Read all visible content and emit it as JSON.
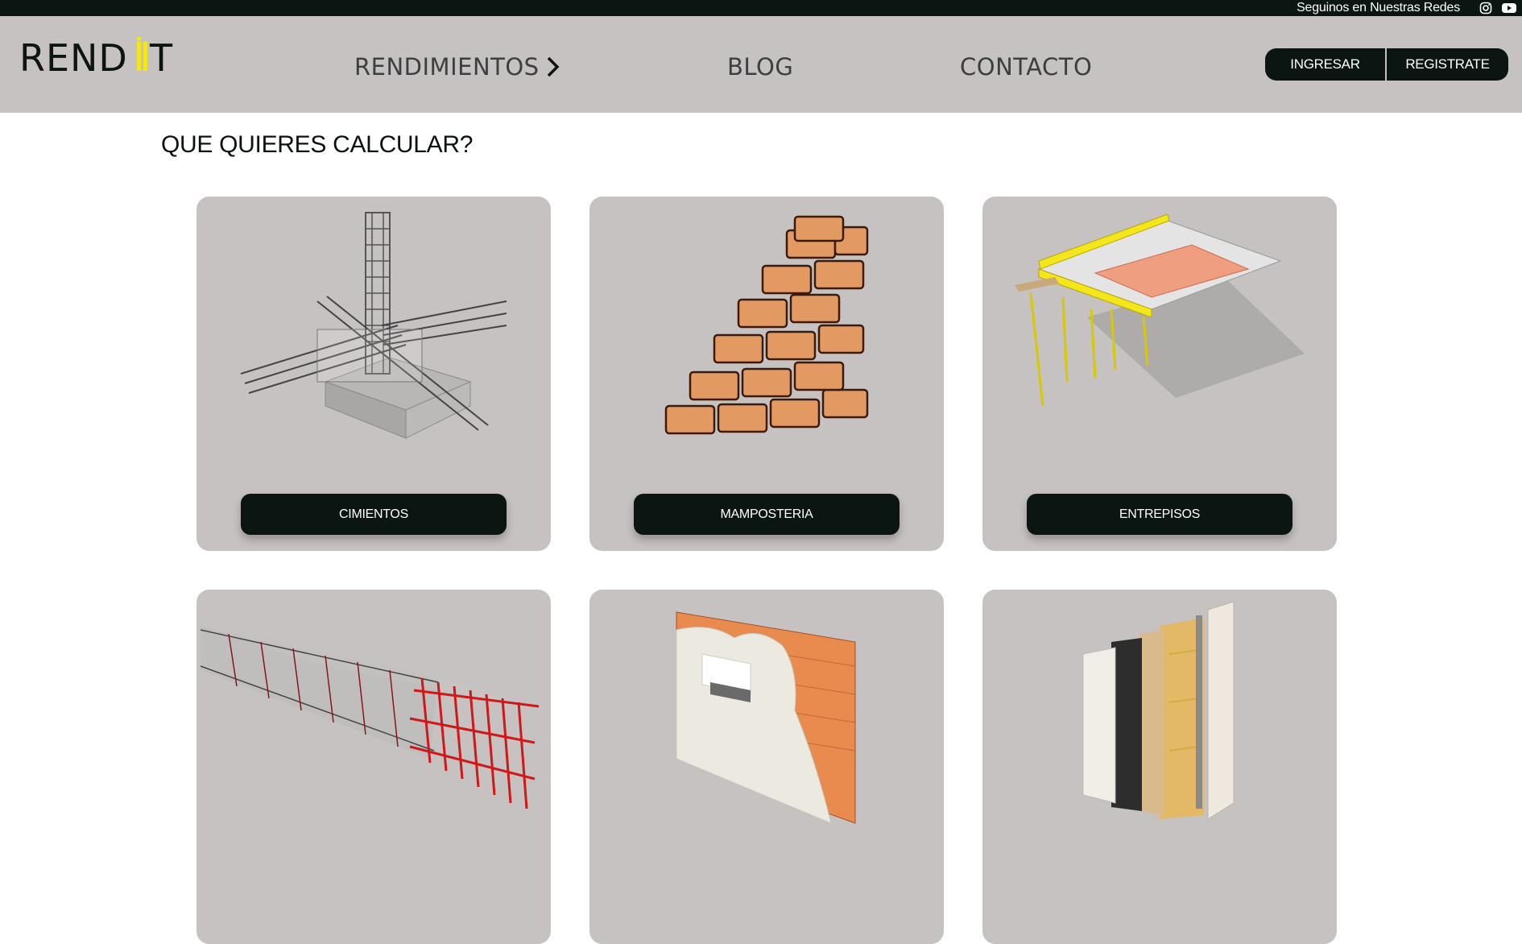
{
  "topbar": {
    "social_text": "Seguinos en Nuestras Redes",
    "icons": [
      "instagram-icon",
      "youtube-icon"
    ]
  },
  "header": {
    "logo_text": "RENDIT",
    "nav": {
      "rendimientos": "RENDIMIENTOS",
      "blog": "BLOG",
      "contacto": "CONTACTO"
    },
    "auth": {
      "login": "INGRESAR",
      "register": "REGISTRATE"
    }
  },
  "main": {
    "title": "QUE QUIERES CALCULAR?",
    "cards": [
      {
        "label": "CIMIENTOS"
      },
      {
        "label": "MAMPOSTERIA"
      },
      {
        "label": "ENTREPISOS"
      },
      {
        "label": ""
      },
      {
        "label": ""
      },
      {
        "label": ""
      }
    ]
  },
  "colors": {
    "dark": "#0b1512",
    "header_bg": "#c6c2c1",
    "card_bg": "#c6c2c1",
    "logo_accent": "#f3e61b",
    "nav_text": "#3c3f3f"
  }
}
